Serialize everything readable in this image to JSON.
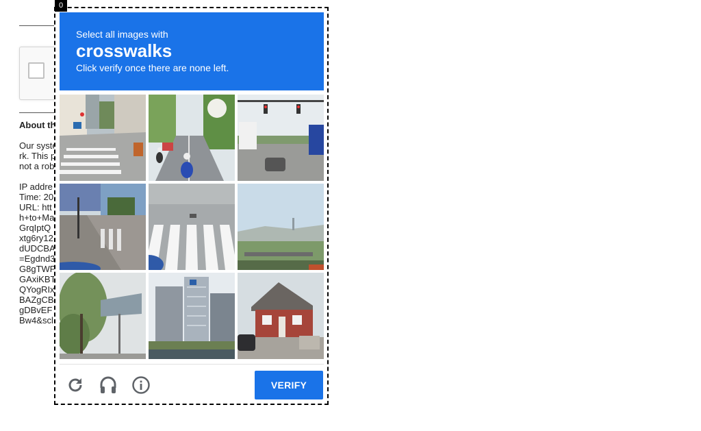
{
  "background_page": {
    "heading": "About th",
    "text_lines": [
      "Our syste",
      "rk. This p",
      "not a rob",
      "",
      "IP addre",
      "Time: 20",
      "URL: htt",
      "h+to+Ma",
      "GrqIptQ",
      "xtg6ry12",
      "dUDCBA",
      "=Egdnd3",
      "G8gTWP",
      "GAxiKBT",
      "QYogRIx",
      "BAZgCB",
      "gDBvEF",
      "Bw4&scl"
    ]
  },
  "challenge": {
    "frame_index": "0",
    "prompt_line1": "Select all images with",
    "prompt_target": "crosswalks",
    "prompt_line3": "Click verify once there are none left.",
    "verify_label": "VERIFY",
    "header_color": "#1a73e8",
    "tiles": [
      {
        "scene": "street crosswalk with buildings"
      },
      {
        "scene": "motorcycles on tree-lined road"
      },
      {
        "scene": "intersection with traffic lights and trucks"
      },
      {
        "scene": "sidewalk and street corner"
      },
      {
        "scene": "close-up crosswalk stripes"
      },
      {
        "scene": "hazy city skyline with bridge"
      },
      {
        "scene": "highway sign and trees"
      },
      {
        "scene": "tall glass buildings"
      },
      {
        "scene": "red brick house with car"
      }
    ]
  },
  "icons": {
    "reload": "reload-icon",
    "audio": "headphones-icon",
    "info": "info-icon"
  }
}
